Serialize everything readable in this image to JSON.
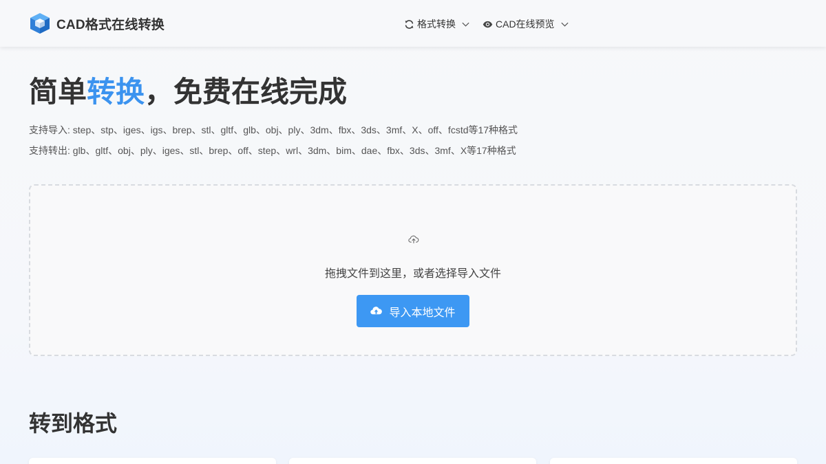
{
  "brand": {
    "name": "CAD格式在线转换",
    "icon": "cube-icon",
    "icon_color": "#2f7fd8"
  },
  "nav": {
    "items": [
      {
        "label": "格式转换",
        "icon": "refresh-icon"
      },
      {
        "label": "CAD在线预览",
        "icon": "eye-icon"
      }
    ]
  },
  "hero": {
    "title_pre": "简单",
    "title_highlight": "转换",
    "title_post": "，免费在线完成",
    "support_import": "支持导入: step、stp、iges、igs、brep、stl、gltf、glb、obj、ply、3dm、fbx、3ds、3mf、X、off、fcstd等17种格式",
    "support_export": "支持转出: glb、gltf、obj、ply、iges、stl、brep、off、step、wrl、3dm、bim、dae、fbx、3ds、3mf、X等17种格式"
  },
  "dropzone": {
    "prompt": "拖拽文件到这里，或者选择导入文件",
    "button_label": "导入本地文件",
    "icon": "cloud-upload-icon"
  },
  "section": {
    "title": "转到格式"
  },
  "colors": {
    "accent": "#3b93ef",
    "button": "#3d98f3",
    "text": "#333333"
  }
}
